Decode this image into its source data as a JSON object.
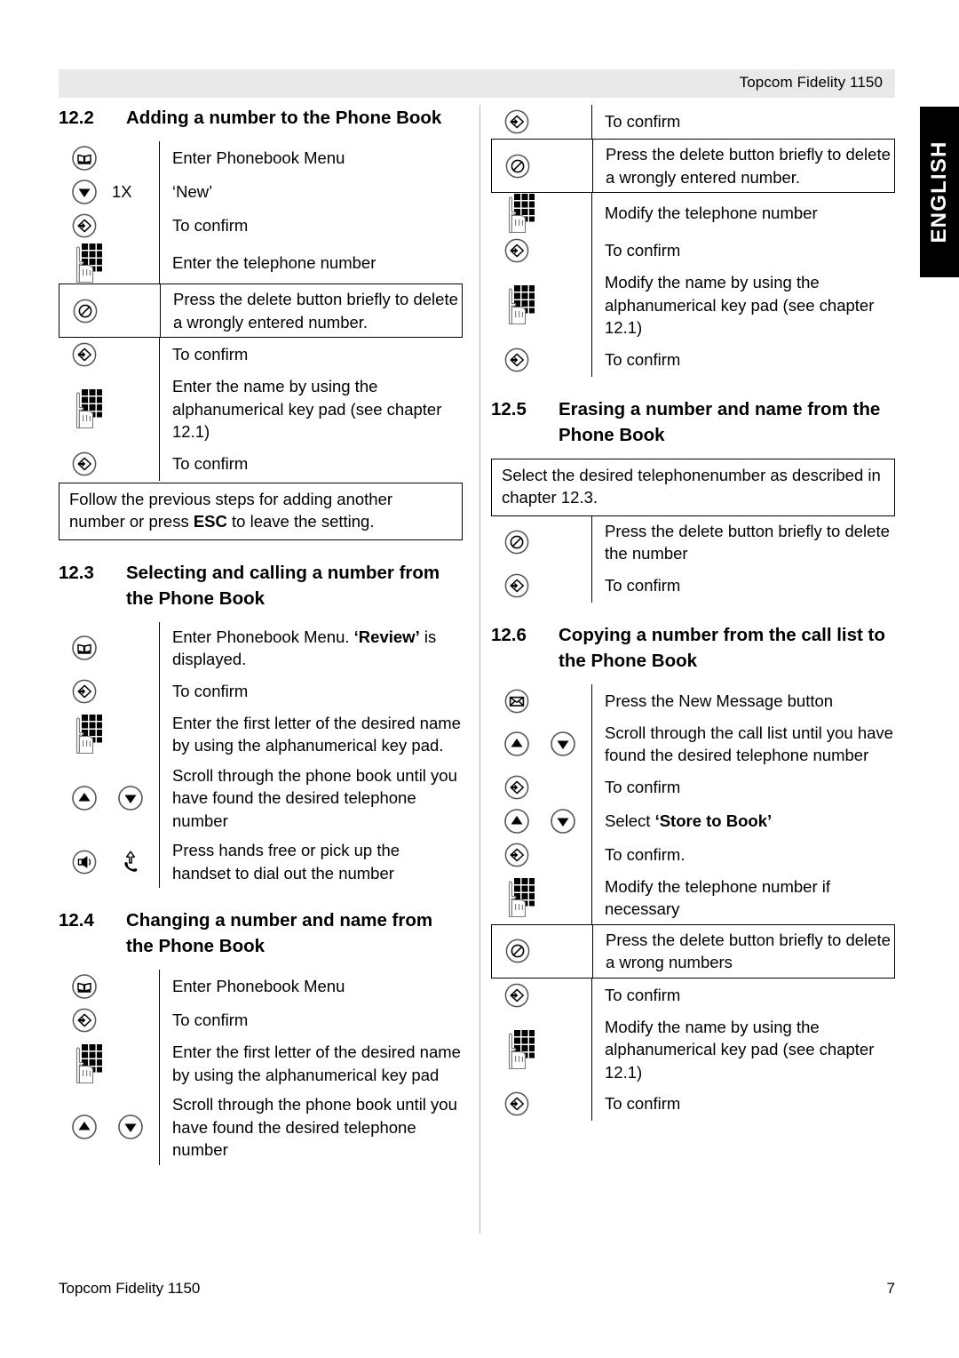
{
  "header": {
    "title": "Topcom Fidelity 1150"
  },
  "lang_tab": {
    "label": "ENGLISH"
  },
  "footer": {
    "left": "Topcom Fidelity 1150",
    "page_number": "7"
  },
  "sections": {
    "s122": {
      "number": "12.2",
      "title": "Adding a number to the Phone Book",
      "steps": [
        {
          "icons": [
            "phonebook-icon"
          ],
          "rep": "",
          "text": "Enter Phonebook Menu"
        },
        {
          "icons": [
            "arrow-down-icon"
          ],
          "rep": "1X",
          "text": "‘New’"
        },
        {
          "icons": [
            "confirm-icon"
          ],
          "rep": "",
          "text": "To confirm"
        },
        {
          "icons": [
            "keypad-hand-icon"
          ],
          "rep": "",
          "text": "Enter the telephone number"
        },
        {
          "icons": [
            "delete-icon"
          ],
          "rep": "",
          "text": "Press the delete button briefly to delete a wrongly entered number.",
          "boxed": true
        },
        {
          "icons": [
            "confirm-icon"
          ],
          "rep": "",
          "text": "To confirm"
        },
        {
          "icons": [
            "keypad-hand-icon"
          ],
          "rep": "",
          "text": "Enter the name by using the alphanumerical key pad (see chapter 12.1)"
        },
        {
          "icons": [
            "confirm-icon"
          ],
          "rep": "",
          "text": "To confirm"
        }
      ],
      "note": "Follow the previous steps for adding another number or press ESC to leave the setting.",
      "note_parts": {
        "before": "Follow the previous steps for adding another number or press ",
        "bold": "ESC",
        "after": " to leave the setting."
      }
    },
    "s123": {
      "number": "12.3",
      "title": "Selecting and calling a number from the Phone Book",
      "steps": [
        {
          "icons": [
            "phonebook-icon"
          ],
          "rep": "",
          "text_parts": {
            "before": "Enter Phonebook Menu. ",
            "bold": "‘Review’",
            "after": " is displayed."
          }
        },
        {
          "icons": [
            "confirm-icon"
          ],
          "rep": "",
          "text": "To confirm"
        },
        {
          "icons": [
            "keypad-hand-icon"
          ],
          "rep": "",
          "text": "Enter the first letter of the desired name by using the alphanumerical key pad."
        },
        {
          "icons": [
            "arrow-up-icon",
            "arrow-down-icon"
          ],
          "rep": "",
          "text": "Scroll through the phone book until you have found the desired telephone number"
        },
        {
          "icons": [
            "speaker-icon",
            "handset-lift-icon"
          ],
          "rep": "",
          "text": "Press hands free or pick up the handset to dial out the number"
        }
      ]
    },
    "s124": {
      "number": "12.4",
      "title": "Changing a number and name from the Phone Book",
      "steps_left": [
        {
          "icons": [
            "phonebook-icon"
          ],
          "rep": "",
          "text": "Enter Phonebook Menu"
        },
        {
          "icons": [
            "confirm-icon"
          ],
          "rep": "",
          "text": "To confirm"
        },
        {
          "icons": [
            "keypad-hand-icon"
          ],
          "rep": "",
          "text": "Enter the first letter of the desired name by using the alphanumerical key pad"
        },
        {
          "icons": [
            "arrow-up-icon",
            "arrow-down-icon"
          ],
          "rep": "",
          "text": "Scroll through the phone book until you have found the desired telephone number"
        }
      ],
      "steps_right": [
        {
          "icons": [
            "confirm-icon"
          ],
          "rep": "",
          "text": "To confirm"
        },
        {
          "icons": [
            "delete-icon"
          ],
          "rep": "",
          "text": "Press the delete button briefly to delete a wrongly entered number.",
          "boxed": true
        },
        {
          "icons": [
            "keypad-hand-icon"
          ],
          "rep": "",
          "text": "Modify the telephone number"
        },
        {
          "icons": [
            "confirm-icon"
          ],
          "rep": "",
          "text": "To confirm"
        },
        {
          "icons": [
            "keypad-hand-icon"
          ],
          "rep": "",
          "text": "Modify the name by using the alphanumerical key pad (see chapter 12.1)"
        },
        {
          "icons": [
            "confirm-icon"
          ],
          "rep": "",
          "text": "To confirm"
        }
      ]
    },
    "s125": {
      "number": "12.5",
      "title": "Erasing a number and name from the Phone Book",
      "note": "Select the desired telephonenumber as described in chapter 12.3.",
      "steps": [
        {
          "icons": [
            "delete-icon"
          ],
          "rep": "",
          "text": "Press the delete button briefly to delete the number"
        },
        {
          "icons": [
            "confirm-icon"
          ],
          "rep": "",
          "text": "To confirm"
        }
      ]
    },
    "s126": {
      "number": "12.6",
      "title": "Copying a number from the call list to the Phone Book",
      "steps": [
        {
          "icons": [
            "envelope-icon"
          ],
          "rep": "",
          "text": "Press the New Message button"
        },
        {
          "icons": [
            "arrow-up-icon",
            "arrow-down-icon"
          ],
          "rep": "",
          "text": "Scroll through the call list until you have found the desired telephone number"
        },
        {
          "icons": [
            "confirm-icon"
          ],
          "rep": "",
          "text": "To confirm"
        },
        {
          "icons": [
            "arrow-up-icon",
            "arrow-down-icon"
          ],
          "rep": "",
          "text_parts": {
            "before": "Select ",
            "bold": "‘Store to Book’",
            "after": ""
          }
        },
        {
          "icons": [
            "confirm-icon"
          ],
          "rep": "",
          "text": "To confirm."
        },
        {
          "icons": [
            "keypad-hand-icon"
          ],
          "rep": "",
          "text": "Modify the telephone number if necessary"
        },
        {
          "icons": [
            "delete-icon"
          ],
          "rep": "",
          "text": "Press the delete button briefly to delete a wrong numbers",
          "boxed": true
        },
        {
          "icons": [
            "confirm-icon"
          ],
          "rep": "",
          "text": "To confirm"
        },
        {
          "icons": [
            "keypad-hand-icon"
          ],
          "rep": "",
          "text": "Modify the name by using the alphanumerical key pad (see chapter 12.1)"
        },
        {
          "icons": [
            "confirm-icon"
          ],
          "rep": "",
          "text": "To confirm"
        }
      ]
    }
  },
  "colors": {
    "header_band": "#e9e9e9",
    "lang_tab_bg": "#000000",
    "lang_tab_text": "#ffffff",
    "rule": "#b6b6b6",
    "text": "#000000"
  }
}
